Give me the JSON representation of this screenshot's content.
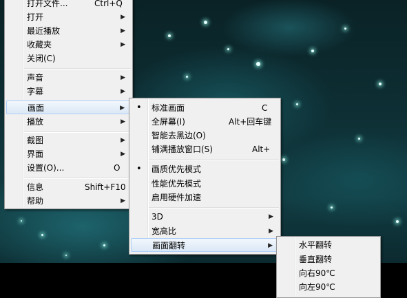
{
  "main_menu": {
    "items": [
      {
        "label": "打开文件...",
        "shortcut": "Ctrl+Q"
      },
      {
        "label": "打开",
        "arrow": "▶"
      },
      {
        "label": "最近播放",
        "arrow": "▶"
      },
      {
        "label": "收藏夹",
        "arrow": "▶"
      },
      {
        "label": "关闭(C)"
      },
      {
        "label": "声音",
        "arrow": "▶"
      },
      {
        "label": "字幕",
        "arrow": "▶"
      },
      {
        "label": "画面",
        "arrow": "▶"
      },
      {
        "label": "播放",
        "arrow": "▶"
      },
      {
        "label": "截图",
        "arrow": "▶"
      },
      {
        "label": "界面",
        "arrow": "▶"
      },
      {
        "label": "设置(O)...",
        "shortcut": "O"
      },
      {
        "label": "信息",
        "shortcut": "Shift+F10"
      },
      {
        "label": "帮助",
        "arrow": "▶"
      }
    ]
  },
  "picture_menu": {
    "items": [
      {
        "label": "标准画面",
        "shortcut": "C",
        "bullet": "•"
      },
      {
        "label": "全屏幕(I)",
        "shortcut": "Alt+回车键"
      },
      {
        "label": "智能去黑边(O)"
      },
      {
        "label": "铺满播放窗口(S)",
        "shortcut": "Alt+"
      },
      {
        "label": "画质优先模式",
        "bullet": "•"
      },
      {
        "label": "性能优先模式"
      },
      {
        "label": "启用硬件加速"
      },
      {
        "label": "3D",
        "arrow": "▶"
      },
      {
        "label": "宽高比",
        "arrow": "▶"
      },
      {
        "label": "画面翻转",
        "arrow": "▶"
      }
    ]
  },
  "flip_menu": {
    "items": [
      {
        "label": "水平翻转"
      },
      {
        "label": "垂直翻转"
      },
      {
        "label": "向右90℃"
      },
      {
        "label": "向左90℃"
      }
    ]
  }
}
